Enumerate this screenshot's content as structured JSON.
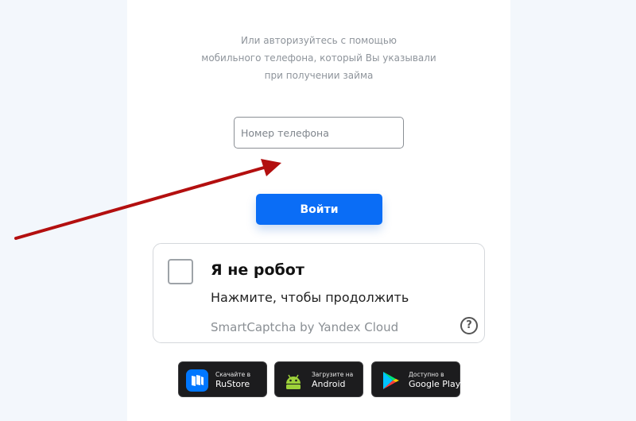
{
  "login": {
    "instructions_lines": [
      "Или авторизуйтесь с помощью",
      "мобильного телефона, который Вы указывали",
      "при получении займа"
    ],
    "phone_placeholder": "Номер телефона",
    "phone_value": "",
    "submit_label": "Войти"
  },
  "captcha": {
    "checked": false,
    "title": "Я не робот",
    "subtitle": "Нажмите, чтобы продолжить",
    "brand": "SmartCaptcha by Yandex Cloud",
    "help_icon": "?"
  },
  "stores": [
    {
      "small": "Скачайте в",
      "big": "RuStore",
      "icon": "rustore-icon"
    },
    {
      "small": "Загрузите на",
      "big": "Android",
      "icon": "android-icon"
    },
    {
      "small": "Доступно в",
      "big": "Google Play",
      "icon": "google-play-icon"
    }
  ],
  "colors": {
    "primary_button": "#0a6df6",
    "annotation_arrow": "#b30f0f",
    "background": "#f3f7fc"
  }
}
